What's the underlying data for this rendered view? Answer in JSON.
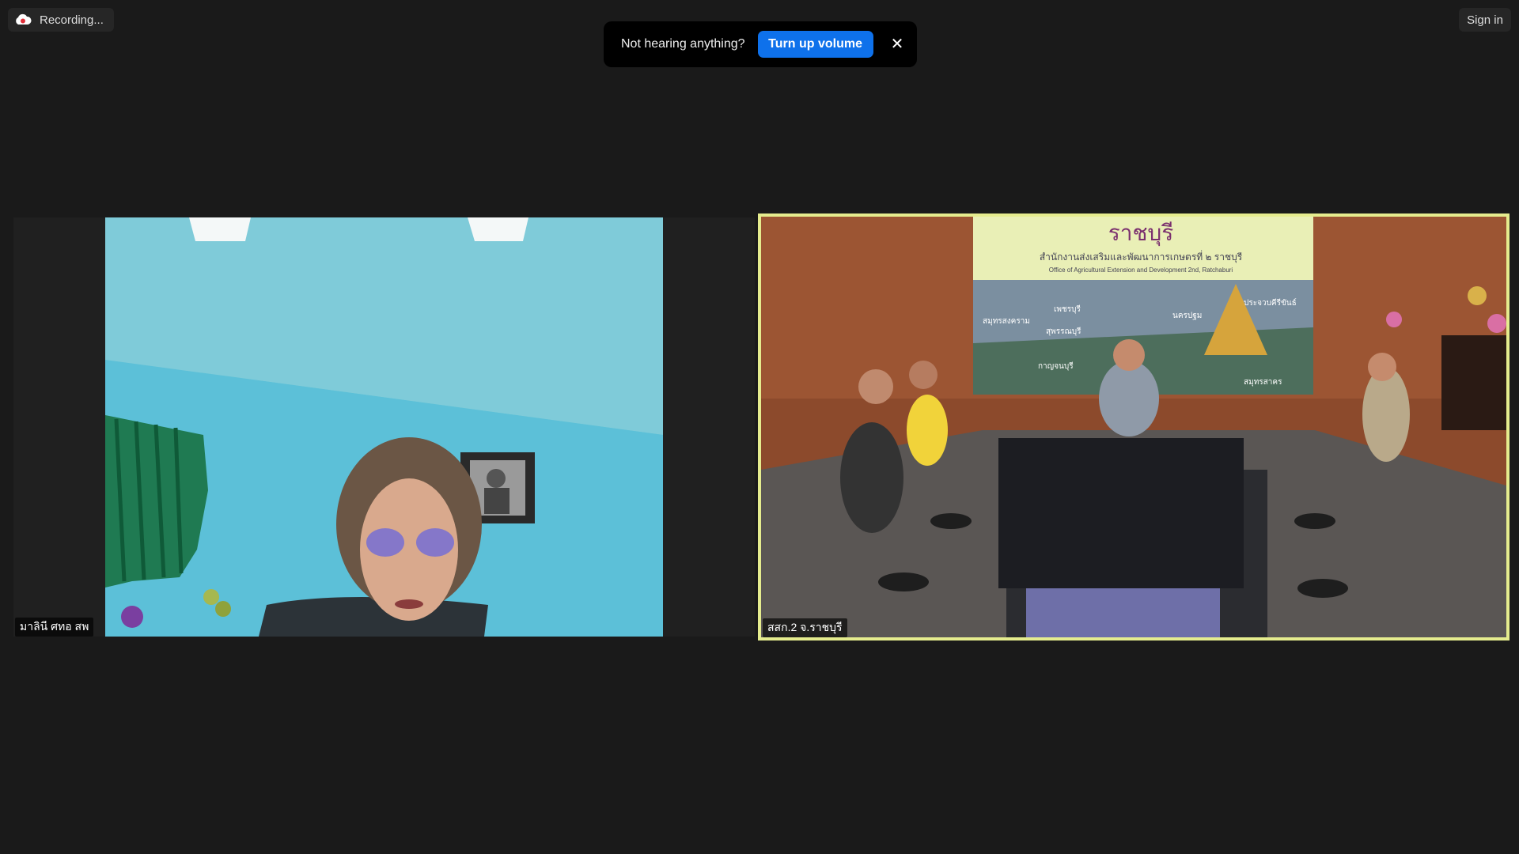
{
  "top_bar": {
    "recording_label": "Recording...",
    "recording_icon": "cloud-record-icon",
    "sign_in_label": "Sign in"
  },
  "toast": {
    "message": "Not hearing anything?",
    "action_label": "Turn up volume",
    "close_icon": "close-icon"
  },
  "participants": [
    {
      "name": "มาลินี ศทอ สพ"
    },
    {
      "name": "สสก.2 จ.ราชบุรี"
    }
  ],
  "banner": {
    "title": "ราชบุรี",
    "subtitle_th": "สำนักงานส่งเสริมและพัฒนาการเกษตรที่ ๒ ราชบุรี",
    "subtitle_en": "Office of Agricultural Extension and Development 2nd, Ratchaburi",
    "provinces": [
      "เพชรบุรี",
      "สมุทรสงคราม",
      "สุพรรณบุรี",
      "นครปฐม",
      "ประจวบคีรีขันธ์",
      "กาญจนบุรี",
      "สมุทรสาคร"
    ]
  },
  "colors": {
    "background": "#1a1a1a",
    "accent_blue": "#0e71eb",
    "active_speaker_border": "#e5ec8e"
  }
}
